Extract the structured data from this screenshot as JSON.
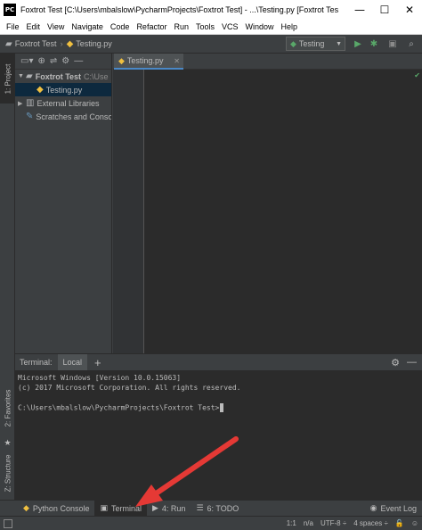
{
  "window": {
    "app_icon": "PC",
    "title": "Foxtrot Test [C:\\Users\\mbalslow\\PycharmProjects\\Foxtrot Test] - ...\\Testing.py [Foxtrot Tes",
    "minimize_glyph": "—",
    "maximize_glyph": "☐",
    "close_glyph": "✕"
  },
  "menu": [
    "File",
    "Edit",
    "View",
    "Navigate",
    "Code",
    "Refactor",
    "Run",
    "Tools",
    "VCS",
    "Window",
    "Help"
  ],
  "navbar": {
    "project": "Foxtrot Test",
    "file": "Testing.py",
    "run_config": "Testing"
  },
  "left_tabs": {
    "project": "1: Project",
    "favorites": "2: Favorites",
    "structure": "Z: Structure"
  },
  "project_tree": [
    {
      "label": "Foxtrot Test",
      "path": "C:\\Use",
      "icon": "folder-icon",
      "expanded": true,
      "indent": 0
    },
    {
      "label": "Testing.py",
      "icon": "python-file-icon",
      "indent": 1,
      "selected": true
    },
    {
      "label": "External Libraries",
      "icon": "library-icon",
      "indent": 0
    },
    {
      "label": "Scratches and Conso",
      "icon": "scratches-icon",
      "indent": 0
    }
  ],
  "editor": {
    "tab_label": "Testing.py"
  },
  "terminal": {
    "title": "Terminal:",
    "tab": "Local",
    "lines": [
      "Microsoft Windows [Version 10.0.15063]",
      "(c) 2017 Microsoft Corporation. All rights reserved.",
      "",
      "C:\\Users\\mbalslow\\PycharmProjects\\Foxtrot Test>"
    ]
  },
  "bottom_tools": {
    "python_console": "Python Console",
    "terminal": "Terminal",
    "run": "4: Run",
    "todo": "6: TODO",
    "event_log": "Event Log"
  },
  "status": {
    "position": "1:1",
    "na": "n/a",
    "encoding": "UTF-8 ÷",
    "indent": "4 spaces ÷"
  },
  "colors": {
    "accent_run": "#59a869",
    "annotation_arrow": "#e53935",
    "selection": "#0d293e"
  }
}
